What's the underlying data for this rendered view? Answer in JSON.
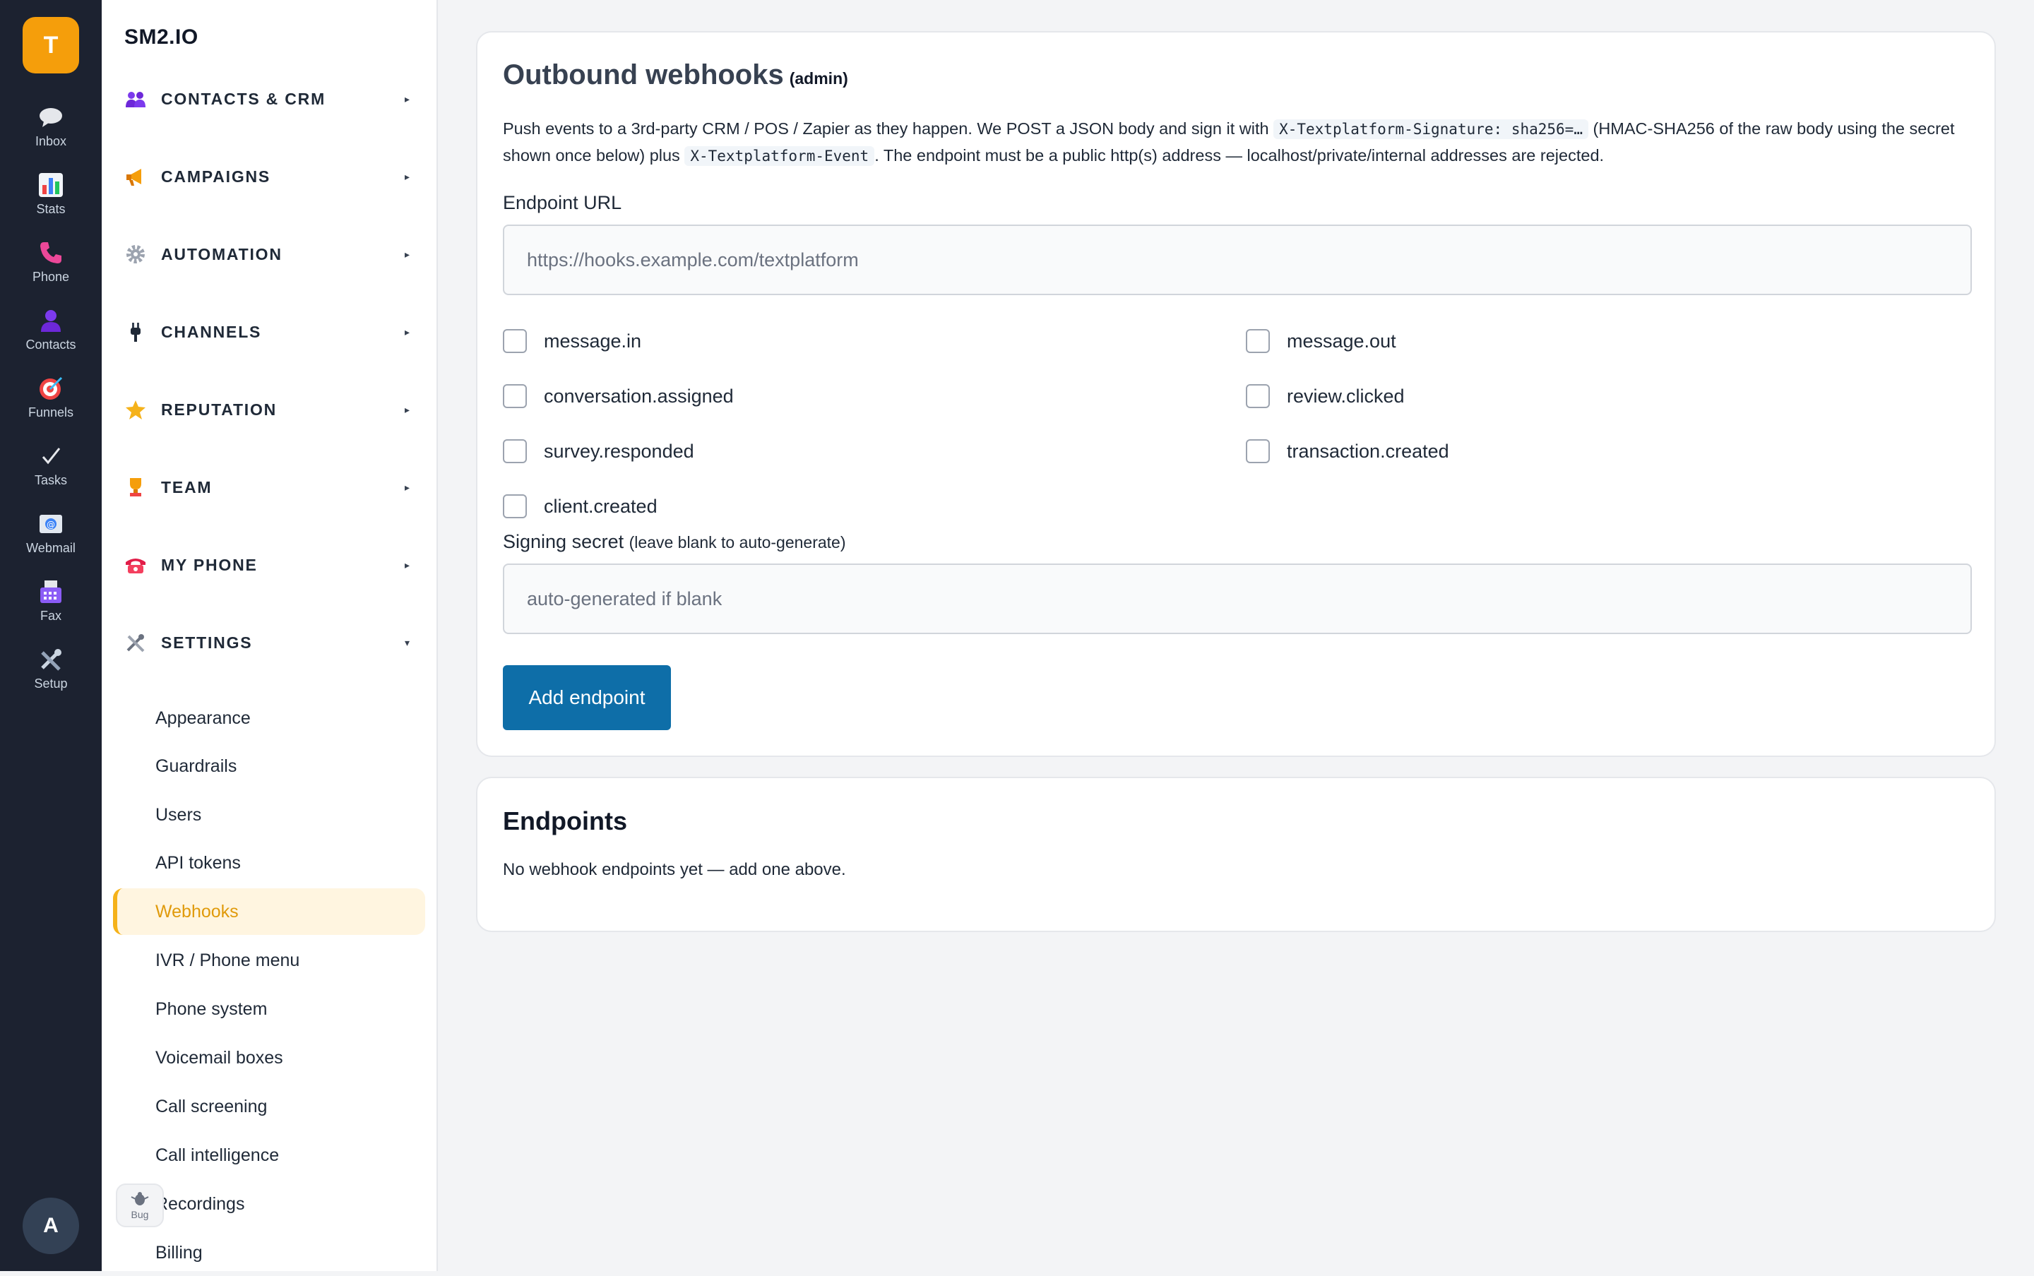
{
  "rail": {
    "logo": "T",
    "items": [
      {
        "label": "Inbox",
        "icon": "chat-bubble-icon"
      },
      {
        "label": "Stats",
        "icon": "bar-chart-icon"
      },
      {
        "label": "Phone",
        "icon": "phone-icon"
      },
      {
        "label": "Contacts",
        "icon": "person-icon"
      },
      {
        "label": "Funnels",
        "icon": "target-icon"
      },
      {
        "label": "Tasks",
        "icon": "checkmark-icon"
      },
      {
        "label": "Webmail",
        "icon": "mail-icon"
      },
      {
        "label": "Fax",
        "icon": "fax-icon"
      },
      {
        "label": "Setup",
        "icon": "tools-icon"
      }
    ],
    "avatar": "A"
  },
  "sidebar": {
    "brand": "SM2.IO",
    "sections": [
      {
        "label": "CONTACTS & CRM",
        "icon": "people-icon",
        "caret": "▸"
      },
      {
        "label": "CAMPAIGNS",
        "icon": "megaphone-icon",
        "caret": "▸"
      },
      {
        "label": "AUTOMATION",
        "icon": "gear-icon",
        "caret": "▸"
      },
      {
        "label": "CHANNELS",
        "icon": "plug-icon",
        "caret": "▸"
      },
      {
        "label": "REPUTATION",
        "icon": "star-icon",
        "caret": "▸"
      },
      {
        "label": "TEAM",
        "icon": "trophy-icon",
        "caret": "▸"
      },
      {
        "label": "MY PHONE",
        "icon": "telephone-icon",
        "caret": "▸"
      },
      {
        "label": "SETTINGS",
        "icon": "tools-icon",
        "caret": "▾"
      }
    ],
    "settings_items": [
      "Appearance",
      "Guardrails",
      "Users",
      "API tokens",
      "Webhooks",
      "IVR / Phone menu",
      "Phone system",
      "Voicemail boxes",
      "Call screening",
      "Call intelligence",
      "Recordings",
      "Billing"
    ],
    "active_item": "Webhooks",
    "bug_label": "Bug"
  },
  "webhooks": {
    "title": "Outbound webhooks",
    "title_badge": "(admin)",
    "desc_1": "Push events to a 3rd-party CRM / POS / Zapier as they happen. We POST a JSON body and sign it with",
    "desc_code_1": "X-Textplatform-Signature: sha256=…",
    "desc_2": "(HMAC-SHA256 of the raw body using the secret shown once below) plus",
    "desc_code_2": "X-Textplatform-Event",
    "desc_3": ". The endpoint must be a public http(s) address — localhost/private/internal addresses are rejected.",
    "url_label": "Endpoint URL",
    "url_value": "",
    "url_placeholder": "https://hooks.example.com/textplatform",
    "events": [
      {
        "label": "message.in",
        "checked": false
      },
      {
        "label": "message.out",
        "checked": false
      },
      {
        "label": "conversation.assigned",
        "checked": false
      },
      {
        "label": "review.clicked",
        "checked": false
      },
      {
        "label": "survey.responded",
        "checked": false
      },
      {
        "label": "transaction.created",
        "checked": false
      },
      {
        "label": "client.created",
        "checked": false
      }
    ],
    "secret_label": "Signing secret",
    "secret_hint": "(leave blank to auto-generate)",
    "secret_value": "",
    "secret_placeholder": "auto-generated if blank",
    "add_button": "Add endpoint"
  },
  "endpoints": {
    "title": "Endpoints",
    "empty": "No webhook endpoints yet — add one above."
  },
  "colors": {
    "accent": "#f59e0b",
    "primary_button": "#0e6ea8",
    "rail_bg": "#1c2230"
  }
}
